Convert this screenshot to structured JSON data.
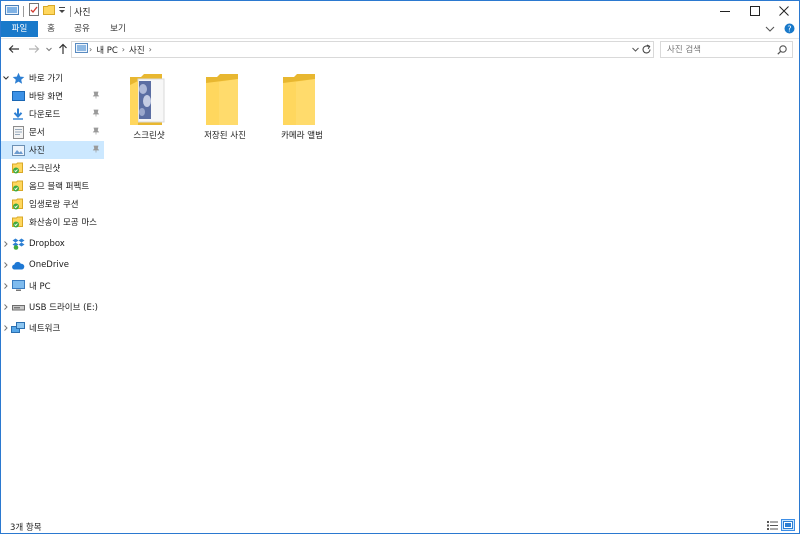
{
  "window": {
    "title": "사진"
  },
  "ribbon": {
    "tabs": [
      {
        "label": "파일",
        "active": true
      },
      {
        "label": "홈",
        "active": false
      },
      {
        "label": "공유",
        "active": false
      },
      {
        "label": "보기",
        "active": false
      }
    ]
  },
  "address": {
    "crumbs": [
      "내 PC",
      "사진"
    ]
  },
  "search": {
    "placeholder": "사진 검색"
  },
  "nav": {
    "quick_access": "바로 가기",
    "pinned": [
      "바탕 화면",
      "다운로드",
      "문서",
      "사진"
    ],
    "recent": [
      "스크린샷",
      "옴므 블랙 퍼펙트",
      "임생로랑 쿠션",
      "화산송이 모공 마스"
    ],
    "dropbox": "Dropbox",
    "onedrive": "OneDrive",
    "this_pc": "내 PC",
    "usb": "USB 드라이브 (E:)",
    "network": "네트워크"
  },
  "content": {
    "items": [
      "스크린샷",
      "저장된 사진",
      "카메라 앨범"
    ]
  },
  "status": {
    "count": "3개 항목"
  },
  "colors": {
    "accent": "#1979ca",
    "selected": "#cce8ff",
    "folder": "#ffd75e",
    "folder_dark": "#e8b730"
  }
}
